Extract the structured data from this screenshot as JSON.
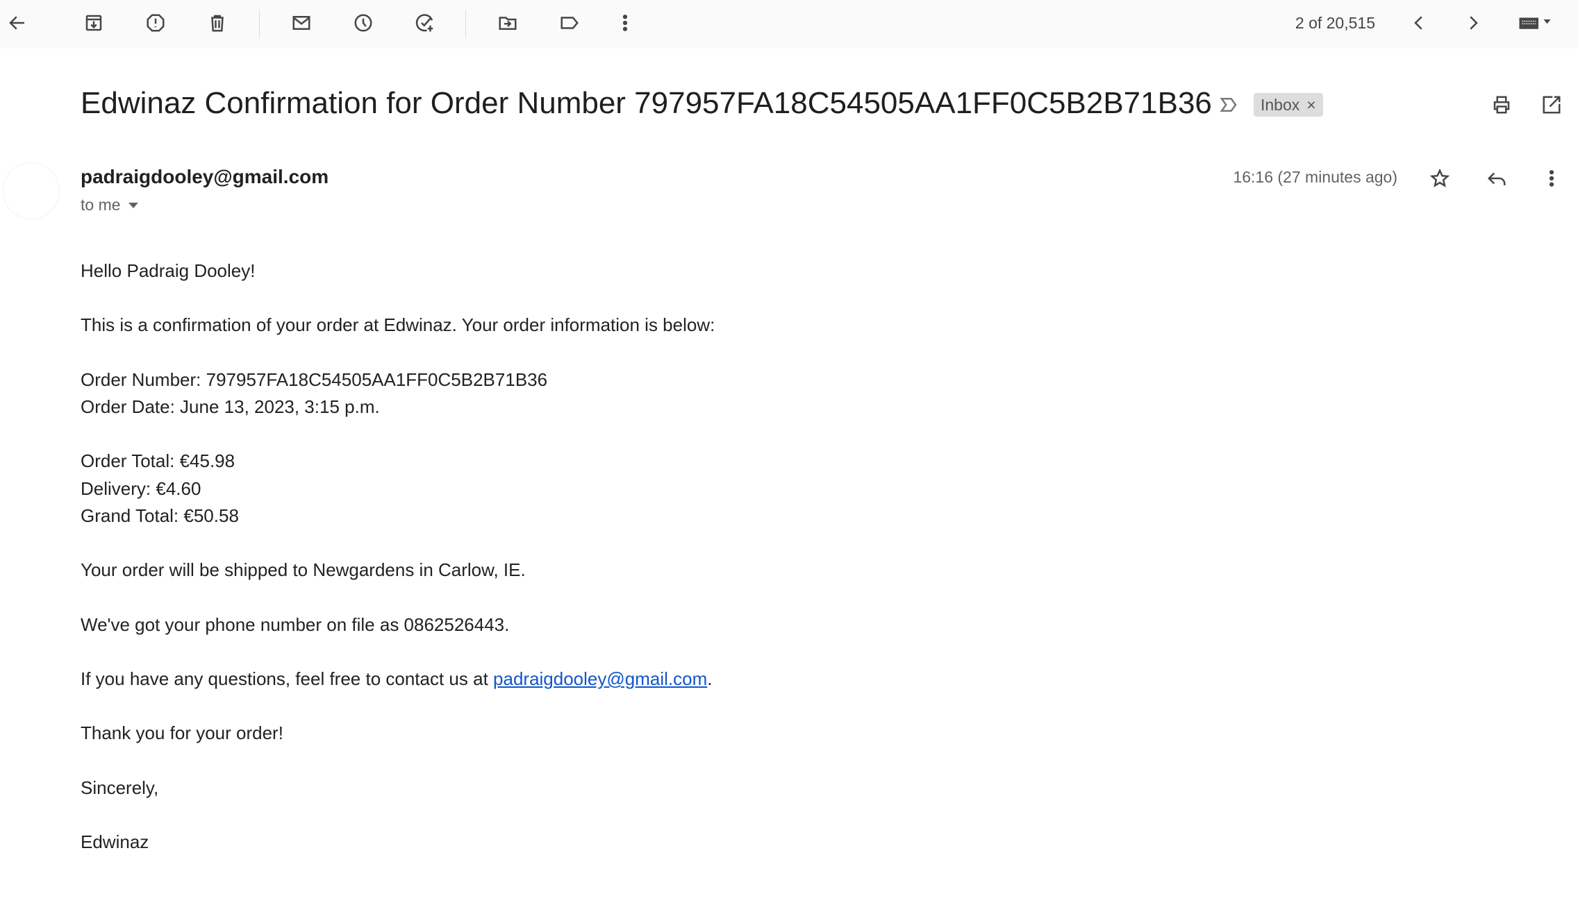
{
  "toolbar": {
    "icons": [
      "back-arrow-icon",
      "archive-icon",
      "report-spam-icon",
      "delete-icon",
      "mark-unread-icon",
      "snooze-icon",
      "add-task-icon",
      "move-to-icon",
      "label-icon",
      "more-vert-icon"
    ],
    "pagination": "2 of 20,515"
  },
  "header": {
    "subject": "Edwinaz Confirmation for Order Number 797957FA18C54505AA1FF0C5B2B71B36",
    "label_chip": "Inbox",
    "label_chip_close": "×"
  },
  "message": {
    "sender": "padraigdooley@gmail.com",
    "recipient": "to me",
    "timestamp": "16:16 (27 minutes ago)"
  },
  "body": {
    "greeting": "Hello Padraig Dooley!",
    "intro": "This is a confirmation of your order at Edwinaz. Your order information is below:",
    "order_number": "Order Number: 797957FA18C54505AA1FF0C5B2B71B36",
    "order_date": "Order Date: June 13, 2023, 3:15 p.m.",
    "order_total": "Order Total: €45.98",
    "delivery": "Delivery: €4.60",
    "grand_total": "Grand Total: €50.58",
    "shipping": "Your order will be shipped to Newgardens in Carlow, IE.",
    "phone": "We've got your phone number on file as 0862526443.",
    "contact_prefix": "If you have any questions, feel free to contact us at ",
    "contact_email": "padraigdooley@gmail.com",
    "contact_suffix": ".",
    "thanks": "Thank you for your order!",
    "signoff": "Sincerely,",
    "signature": "Edwinaz"
  },
  "colors": {
    "link": "#1155cc",
    "toolbar_bg": "#fafafa",
    "chip_bg": "#dddddd"
  }
}
